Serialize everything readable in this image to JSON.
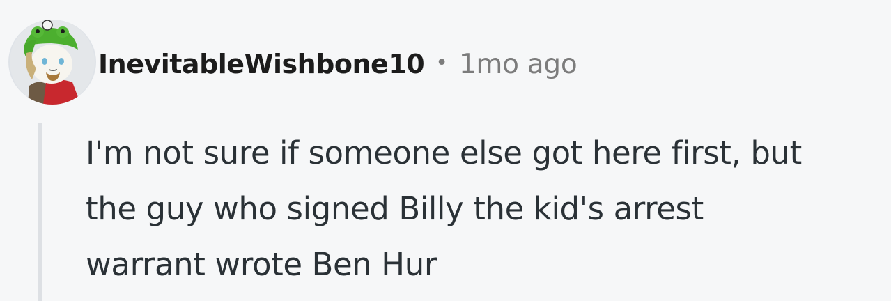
{
  "comment": {
    "author": "InevitableWishbone10",
    "separator": "•",
    "timestamp": "1mo ago",
    "body_lines": [
      "I'm not sure if someone else got here first, but",
      "the guy who signed Billy the kid's arrest",
      "warrant wrote Ben Hur"
    ]
  },
  "colors": {
    "background": "#f6f7f8",
    "author": "#1c1c1c",
    "meta": "#7c7c7c",
    "body": "#2a3136",
    "thread_line": "#dde0e4"
  },
  "icons": {
    "avatar": "snoo-avatar-green-frog-hat"
  }
}
